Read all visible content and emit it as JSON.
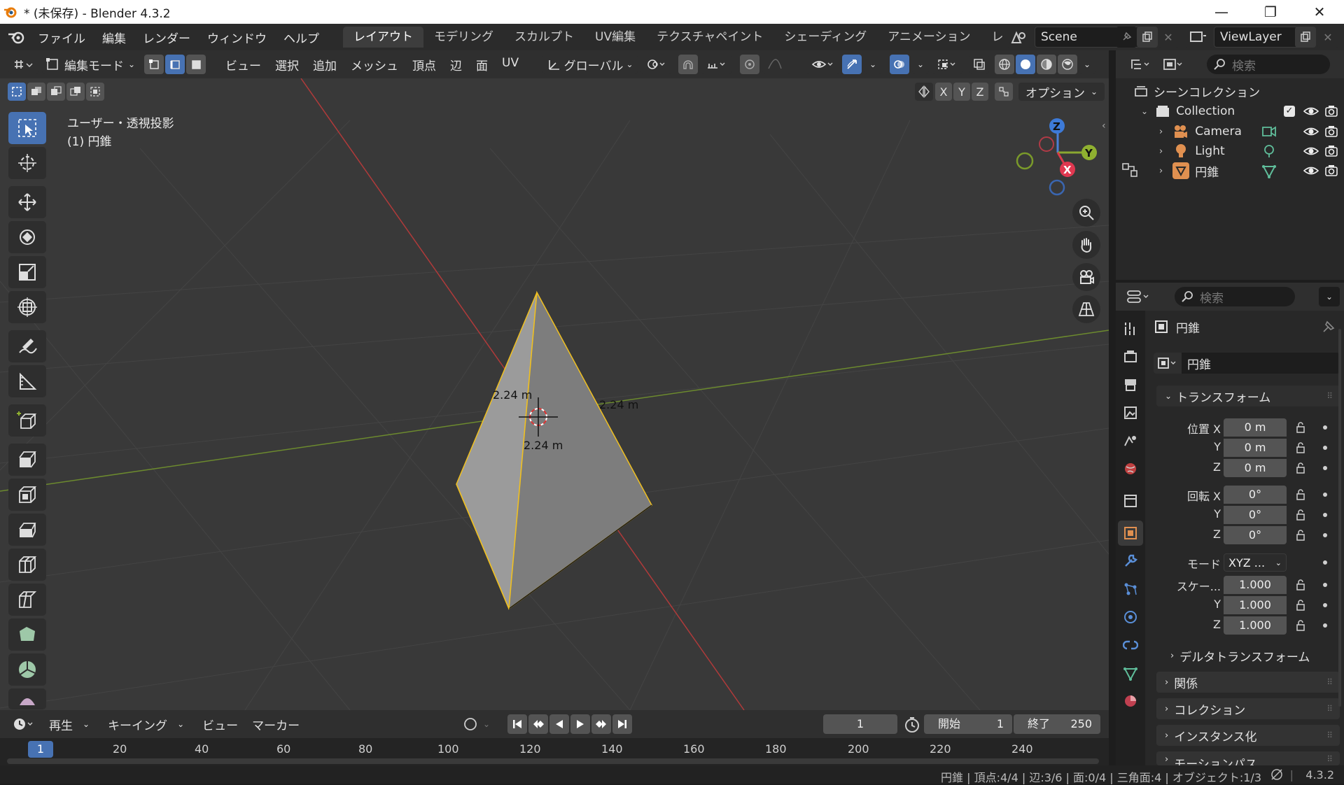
{
  "window": {
    "title": "* (未保存) - Blender 4.3.2"
  },
  "menubar": {
    "items": [
      "ファイル",
      "編集",
      "レンダー",
      "ウィンドウ",
      "ヘルプ"
    ]
  },
  "workspaces": {
    "tabs": [
      "レイアウト",
      "モデリング",
      "スカルプト",
      "UV編集",
      "テクスチャペイント",
      "シェーディング",
      "アニメーション",
      "レ"
    ],
    "active": 0
  },
  "scene": {
    "name": "Scene"
  },
  "viewlayer": {
    "name": "ViewLayer"
  },
  "viewport_header": {
    "mode": "編集モード",
    "menus": [
      "ビュー",
      "選択",
      "追加",
      "メッシュ",
      "頂点",
      "辺",
      "面",
      "UV"
    ],
    "transform_orientation": "グローバル"
  },
  "viewport": {
    "view_name": "ユーザー・透視投影",
    "object_label": "(1) 円錐",
    "axes": [
      "X",
      "Y",
      "Z"
    ],
    "options_label": "オプション",
    "measure": [
      "2.24 m",
      "2.24 m",
      "2.24 m"
    ],
    "gizmo": {
      "x": "X",
      "y": "Y",
      "z": "Z"
    }
  },
  "outliner": {
    "search_placeholder": "検索",
    "scene_collection": "シーンコレクション",
    "collection": "Collection",
    "objects": [
      {
        "name": "Camera",
        "color": "#e09050"
      },
      {
        "name": "Light",
        "color": "#e09050"
      },
      {
        "name": "円錐",
        "color": "#e09050"
      }
    ]
  },
  "properties": {
    "search_placeholder": "検索",
    "object_name": "円錐",
    "datablock_name": "円錐",
    "transform_title": "トランスフォーム",
    "location": {
      "label": "位置 X",
      "x": "0 m",
      "y": "0 m",
      "z": "0 m"
    },
    "rotation": {
      "label": "回転 X",
      "x": "0°",
      "y": "0°",
      "z": "0°"
    },
    "mode": {
      "label": "モード",
      "value": "XYZ ..."
    },
    "scale": {
      "label": "スケー...",
      "x": "1.000",
      "y": "1.000",
      "z": "1.000"
    },
    "axis_y": "Y",
    "axis_z": "Z",
    "sections": [
      "デルタトランスフォーム",
      "関係",
      "コレクション",
      "インスタンス化",
      "モーションパス"
    ]
  },
  "timeline": {
    "menus": [
      "再生",
      "キーイング",
      "ビュー",
      "マーカー"
    ],
    "current_frame": "1",
    "start_label": "開始",
    "start": "1",
    "end_label": "終了",
    "end": "250",
    "ticks": [
      "1",
      "20",
      "40",
      "60",
      "80",
      "100",
      "120",
      "140",
      "160",
      "180",
      "200",
      "220",
      "240"
    ]
  },
  "statusbar": {
    "text": "円錐 | 頂点:4/4 | 辺:3/6 | 面:0/4 | 三角面:4 | オブジェクト:1/3",
    "version": "4.3.2"
  }
}
